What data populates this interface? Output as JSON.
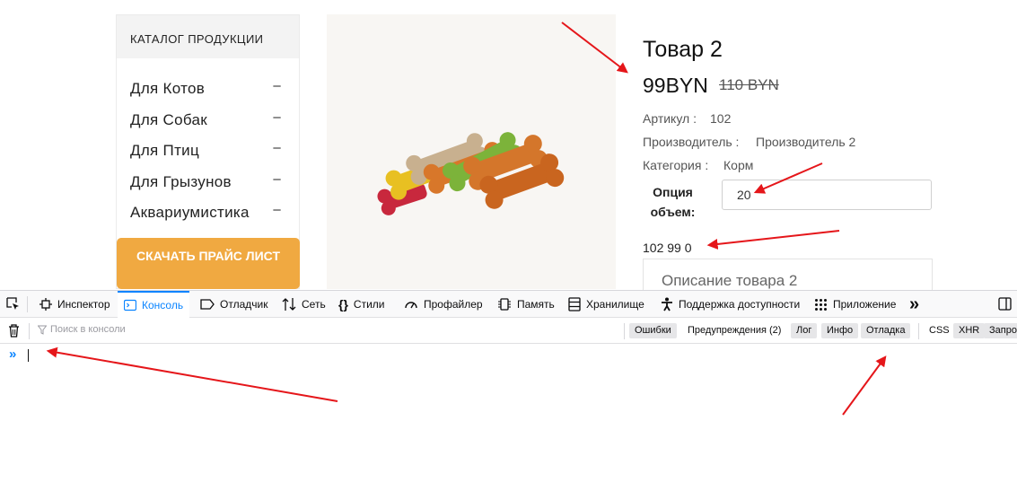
{
  "sidebar": {
    "header": "КАТАЛОГ ПРОДУКЦИИ",
    "items": [
      {
        "label": "Для Котов",
        "toggle": "–"
      },
      {
        "label": "Для Собак",
        "toggle": "–"
      },
      {
        "label": "Для Птиц",
        "toggle": "–"
      },
      {
        "label": "Для Грызунов",
        "toggle": "–"
      },
      {
        "label": "Аквариумистика",
        "toggle": "–"
      }
    ],
    "price_button": "СКАЧАТЬ ПРАЙС ЛИСТ"
  },
  "product": {
    "title": "Товар 2",
    "price": "99BYN",
    "old_price": "110 BYN",
    "article_label": "Артикул :",
    "article_value": "102",
    "maker_label": "Производитель :",
    "maker_value": "Производитель 2",
    "category_label": "Категория :",
    "category_value": "Корм",
    "option_label": "Опция объем:",
    "option_value": "20",
    "sum_line": "102 99 0",
    "description_tab": "Описание товара 2"
  },
  "devtools": {
    "tabs": [
      {
        "label": "Инспектор",
        "icon": "inspector-icon"
      },
      {
        "label": "Консоль",
        "icon": "console-icon"
      },
      {
        "label": "Отладчик",
        "icon": "debugger-icon"
      },
      {
        "label": "Сеть",
        "icon": "network-icon"
      },
      {
        "label": "Стили",
        "icon": "style-editor-icon"
      },
      {
        "label": "Профайлер",
        "icon": "profiler-icon"
      },
      {
        "label": "Память",
        "icon": "memory-icon"
      },
      {
        "label": "Хранилище",
        "icon": "storage-icon"
      },
      {
        "label": "Поддержка доступности",
        "icon": "accessibility-icon"
      },
      {
        "label": "Приложение",
        "icon": "application-icon"
      }
    ],
    "more": "»",
    "filter_placeholder": "Поиск в консоли",
    "filters": [
      "Ошибки",
      "Предупреждения (2)",
      "Лог",
      "Инфо",
      "Отладка",
      "CSS",
      "XHR",
      "Запро"
    ],
    "prompt": "»"
  },
  "colors": {
    "accent_button": "#f0a941",
    "devtools_accent": "#0a84ff",
    "annotation_arrow": "#e5161a"
  }
}
